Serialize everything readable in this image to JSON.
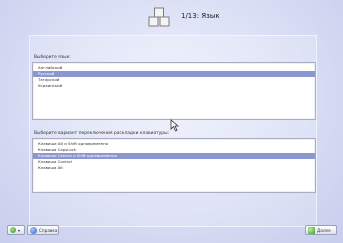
{
  "header": {
    "title": "1/13: Язык",
    "icon": "keyboard-cubes-icon"
  },
  "language_section": {
    "label": "Выберите язык:",
    "items": [
      {
        "label": "Английский",
        "selected": false
      },
      {
        "label": "Русский",
        "selected": true
      },
      {
        "label": "Татарский",
        "selected": false
      },
      {
        "label": "Украинский",
        "selected": false
      }
    ]
  },
  "layout_section": {
    "label": "Выберите вариант переключения раскладки клавиатуры:",
    "items": [
      {
        "label": "Клавиши Alt и Shift одновременно",
        "selected": false
      },
      {
        "label": "Клавиша CapsLock",
        "selected": false
      },
      {
        "label": "Клавиши Control и Shift одновременно",
        "selected": true
      },
      {
        "label": "Клавиша Control",
        "selected": false
      },
      {
        "label": "Клавиша Alt",
        "selected": false
      }
    ]
  },
  "footer": {
    "menu_button": {
      "icon": "globe-icon"
    },
    "help_button": {
      "label": "Справка",
      "icon": "help-icon"
    },
    "next_button": {
      "label": "Далее",
      "icon": "next-arrow-icon"
    }
  },
  "colors": {
    "selection": "#8c97d2",
    "background": "#d9def5"
  }
}
